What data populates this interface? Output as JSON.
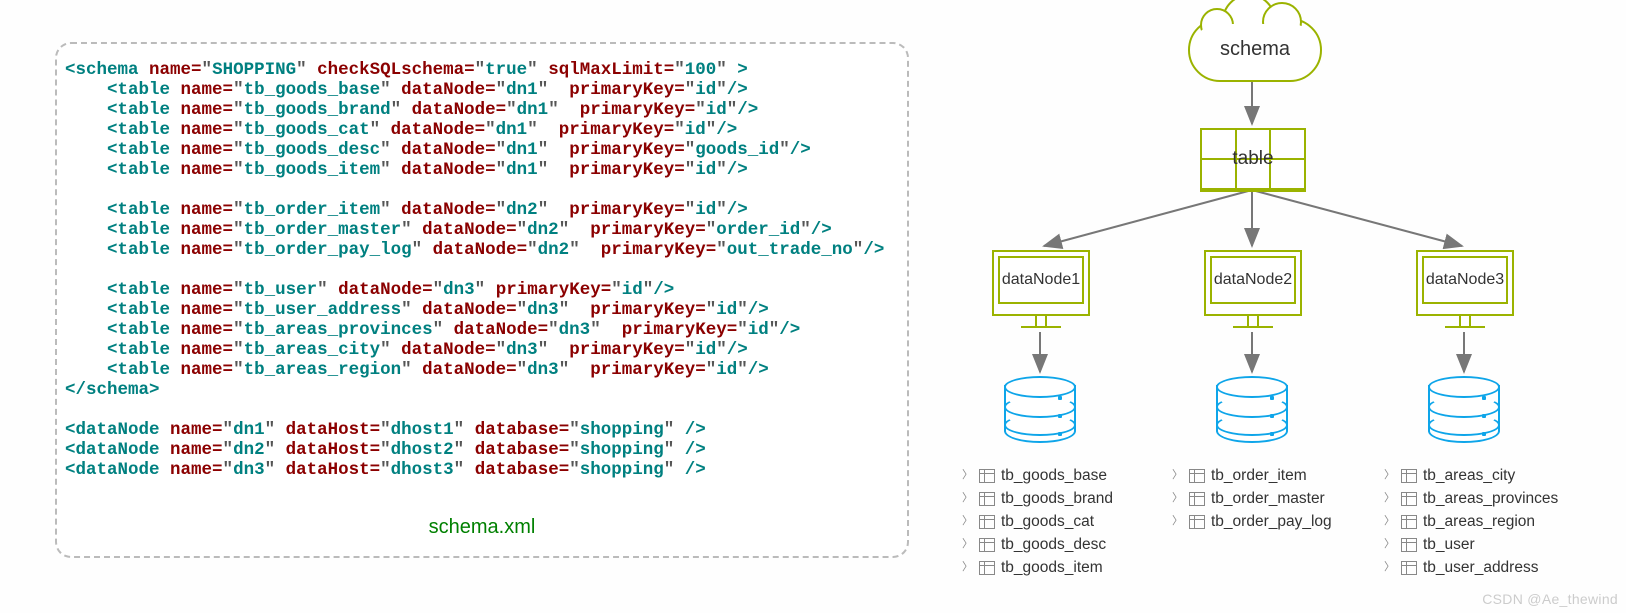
{
  "caption": "schema.xml",
  "schema": {
    "name": "SHOPPING",
    "checkSQLschema": "true",
    "sqlMaxLimit": "100"
  },
  "tables": [
    {
      "name": "tb_goods_base",
      "dataNode": "dn1",
      "primaryKey": "id",
      "indent": 4
    },
    {
      "name": "tb_goods_brand",
      "dataNode": "dn1",
      "primaryKey": "id",
      "indent": 4
    },
    {
      "name": "tb_goods_cat",
      "dataNode": "dn1",
      "primaryKey": "id",
      "indent": 4
    },
    {
      "name": "tb_goods_desc",
      "dataNode": "dn1",
      "primaryKey": "goods_id",
      "indent": 4
    },
    {
      "name": "tb_goods_item",
      "dataNode": "dn1",
      "primaryKey": "id",
      "indent": 4
    },
    {
      "blank": true
    },
    {
      "name": "tb_order_item",
      "dataNode": "dn2",
      "primaryKey": "id",
      "indent": 4
    },
    {
      "name": "tb_order_master",
      "dataNode": "dn2",
      "primaryKey": "order_id",
      "indent": 4
    },
    {
      "name": "tb_order_pay_log",
      "dataNode": "dn2",
      "primaryKey": "out_trade_no",
      "indent": 4
    },
    {
      "blank": true
    },
    {
      "name": "tb_user",
      "dataNode": "dn3",
      "primaryKey": "id",
      "indent": 4,
      "tight": true
    },
    {
      "name": "tb_user_address",
      "dataNode": "dn3",
      "primaryKey": "id",
      "indent": 4
    },
    {
      "name": "tb_areas_provinces",
      "dataNode": "dn3",
      "primaryKey": "id",
      "indent": 4
    },
    {
      "name": "tb_areas_city",
      "dataNode": "dn3",
      "primaryKey": "id",
      "indent": 4
    },
    {
      "name": "tb_areas_region",
      "dataNode": "dn3",
      "primaryKey": "id",
      "indent": 4
    }
  ],
  "dataNodes": [
    {
      "name": "dn1",
      "dataHost": "dhost1",
      "database": "shopping"
    },
    {
      "name": "dn2",
      "dataHost": "dhost2",
      "database": "shopping"
    },
    {
      "name": "dn3",
      "dataHost": "dhost3",
      "database": "shopping"
    }
  ],
  "diagram": {
    "schemaLabel": "schema",
    "tableLabel": "table",
    "nodes": [
      {
        "label": "dataNode1"
      },
      {
        "label": "dataNode2"
      },
      {
        "label": "dataNode3"
      }
    ],
    "lists": [
      [
        "tb_goods_base",
        "tb_goods_brand",
        "tb_goods_cat",
        "tb_goods_desc",
        "tb_goods_item"
      ],
      [
        "tb_order_item",
        "tb_order_master",
        "tb_order_pay_log"
      ],
      [
        "tb_areas_city",
        "tb_areas_provinces",
        "tb_areas_region",
        "tb_user",
        "tb_user_address"
      ]
    ]
  },
  "watermark": "CSDN @Ae_thewind"
}
